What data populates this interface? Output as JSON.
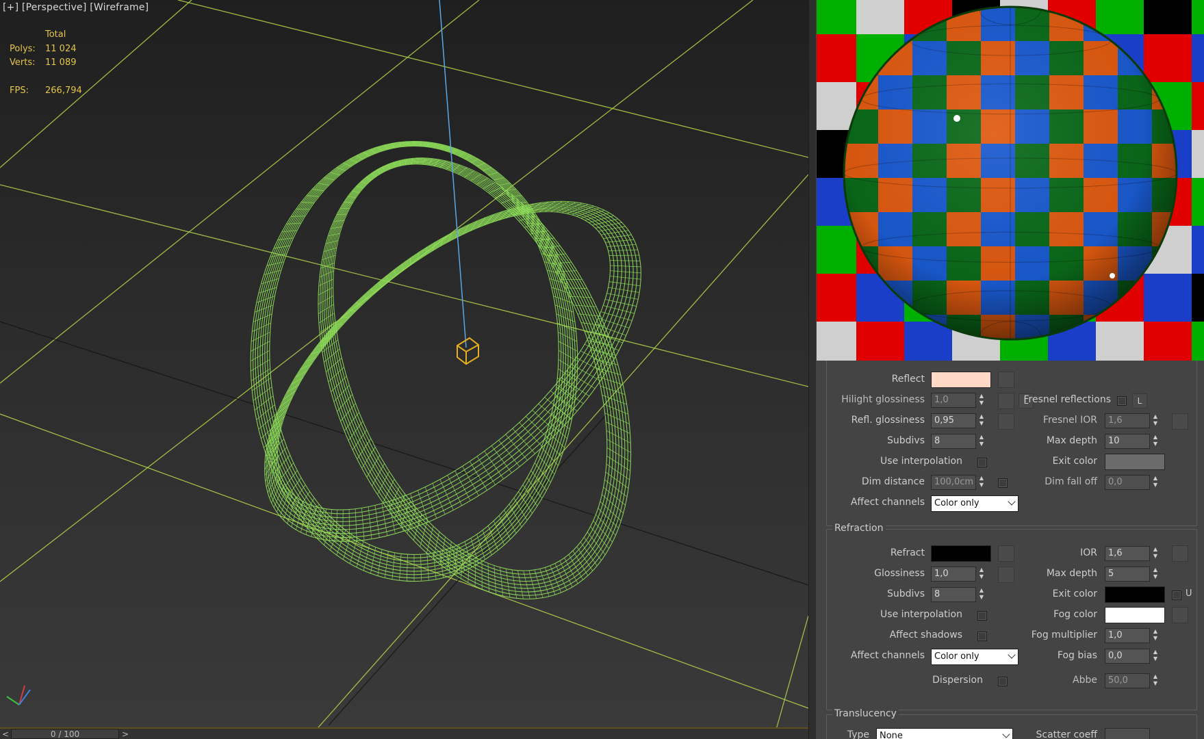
{
  "viewport": {
    "labels": [
      "[+]",
      "[Perspective]",
      "[Wireframe]"
    ],
    "stats": {
      "header": "Total",
      "polys_label": "Polys:",
      "polys_value": "11 024",
      "verts_label": "Verts:",
      "verts_value": "11 089",
      "fps_label": "FPS:",
      "fps_value": "266,794"
    },
    "timeline": {
      "left_arrow": "<",
      "slider": "0 / 100",
      "right_arrow": ">"
    },
    "colors": {
      "wire": "#8fe05a",
      "grid": "#b6d64a",
      "gizmo": "#e8b020",
      "axis_z": "#5aa8e8"
    }
  },
  "reflection": {
    "reflect_label": "Reflect",
    "reflect_color": "#ffd8c8",
    "hilight_gloss_label": "Hilight glossiness",
    "hilight_gloss_value": "1,0",
    "l_button": "L",
    "fresnel_reflections_label": "Fresnel reflections",
    "refl_gloss_label": "Refl. glossiness",
    "refl_gloss_value": "0,95",
    "fresnel_ior_label": "Fresnel IOR",
    "fresnel_ior_value": "1,6",
    "subdivs_label": "Subdivs",
    "subdivs_value": "8",
    "max_depth_label": "Max depth",
    "max_depth_value": "10",
    "use_interp_label": "Use interpolation",
    "exit_color_label": "Exit color",
    "exit_color": "#6b6b6b",
    "dim_distance_label": "Dim distance",
    "dim_distance_value": "100,0cm",
    "dim_falloff_label": "Dim fall off",
    "dim_falloff_value": "0,0",
    "affect_channels_label": "Affect channels",
    "affect_channels_value": "Color only"
  },
  "refraction": {
    "title": "Refraction",
    "refract_label": "Refract",
    "refract_color": "#000000",
    "ior_label": "IOR",
    "ior_value": "1,6",
    "gloss_label": "Glossiness",
    "gloss_value": "1,0",
    "max_depth_label": "Max depth",
    "max_depth_value": "5",
    "subdivs_label": "Subdivs",
    "subdivs_value": "8",
    "exit_color_label": "Exit color",
    "exit_color": "#000000",
    "u_label": "U",
    "use_interp_label": "Use interpolation",
    "fog_color_label": "Fog color",
    "fog_color": "#ffffff",
    "affect_shadows_label": "Affect shadows",
    "fog_mult_label": "Fog multiplier",
    "fog_mult_value": "1,0",
    "affect_channels_label": "Affect channels",
    "affect_channels_value": "Color only",
    "fog_bias_label": "Fog bias",
    "fog_bias_value": "0,0",
    "dispersion_label": "Dispersion",
    "abbe_label": "Abbe",
    "abbe_value": "50,0"
  },
  "translucency": {
    "title": "Translucency",
    "type_label": "Type",
    "type_value": "None",
    "scatter_label": "Scatter coeff"
  },
  "preview": {
    "checker_colors": [
      "#e00000",
      "#00b000",
      "#1a3ec8",
      "#cfcfcf",
      "#000000"
    ]
  }
}
